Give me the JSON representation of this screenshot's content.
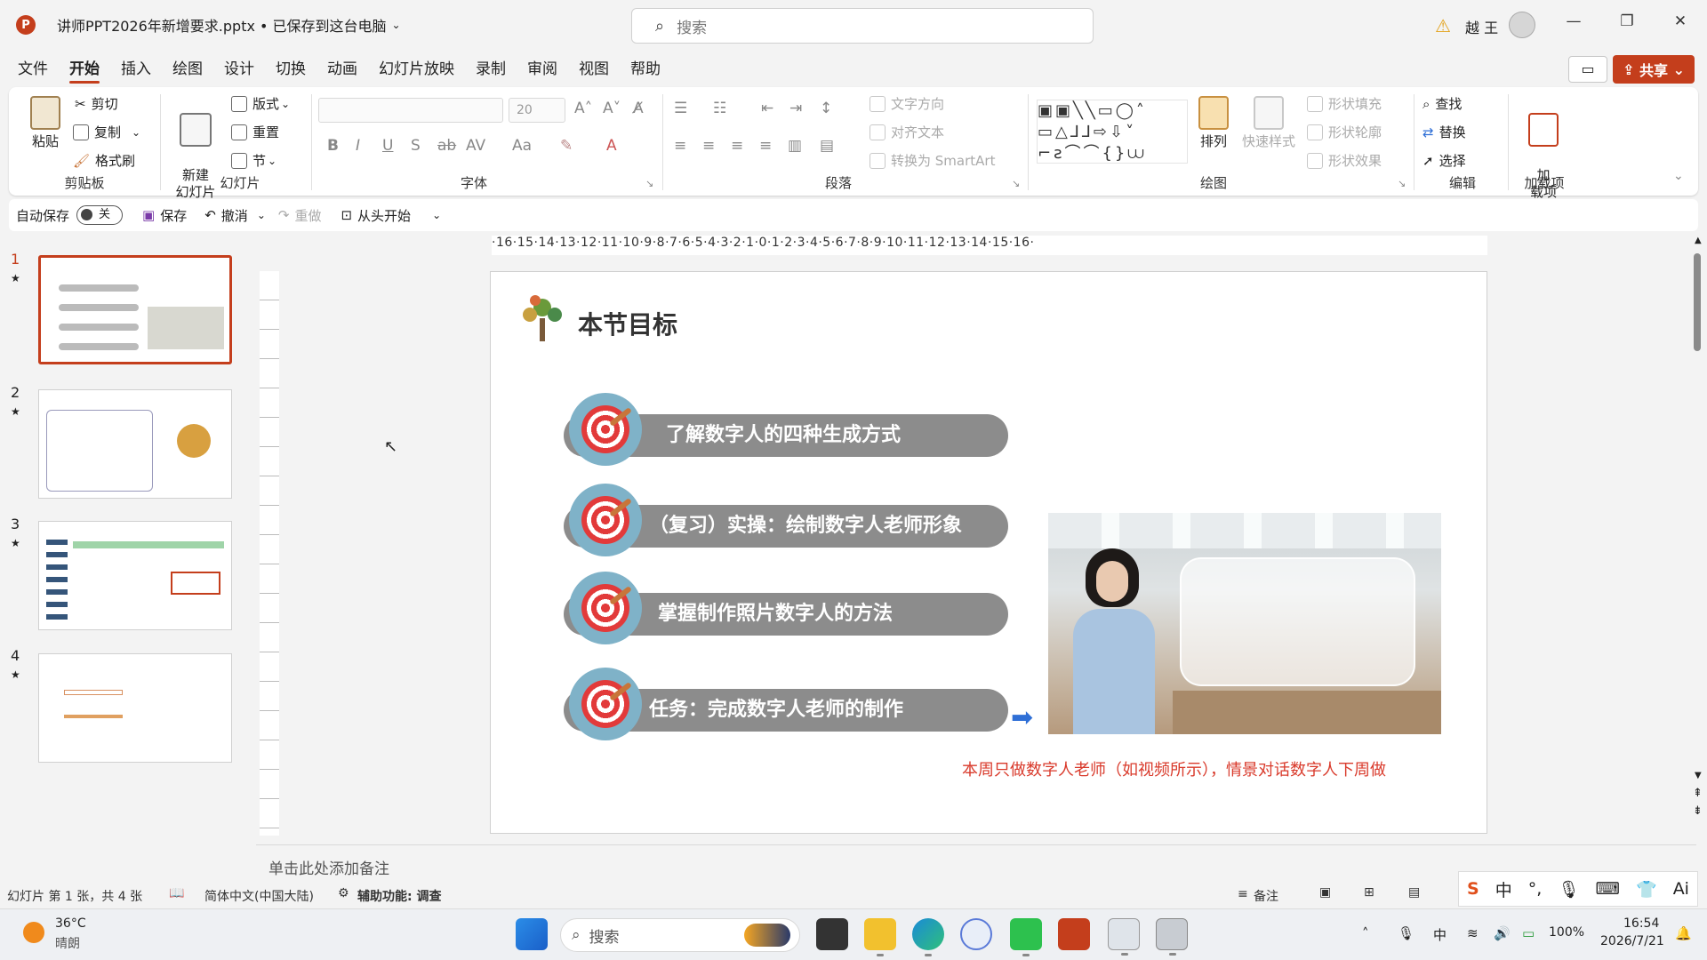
{
  "titlebar": {
    "app_icon_letter": "P",
    "doc_title": "讲师PPT2026年新增要求.pptx • 已保存到这台电脑",
    "search_placeholder": "搜索",
    "user_name": "越 王",
    "minimize": "—",
    "restore": "❐",
    "close": "✕"
  },
  "menu": {
    "tabs": [
      "文件",
      "开始",
      "插入",
      "绘图",
      "设计",
      "切换",
      "动画",
      "幻灯片放映",
      "录制",
      "审阅",
      "视图",
      "帮助"
    ],
    "active": "开始",
    "share_label": "共享"
  },
  "ribbon": {
    "clipboard": {
      "paste": "粘贴",
      "cut": "剪切",
      "copy": "复制",
      "format_painter": "格式刷",
      "label": "剪贴板"
    },
    "slides": {
      "new_slide": "新建\n幻灯片",
      "layout": "版式",
      "reset": "重置",
      "section": "节",
      "label": "幻灯片"
    },
    "font": {
      "font_name": "",
      "font_size": "20",
      "label": "字体"
    },
    "paragraph": {
      "text_direction": "文字方向",
      "align_text": "对齐文本",
      "smartart": "转换为 SmartArt",
      "label": "段落"
    },
    "drawing": {
      "arrange": "排列",
      "quick_styles": "快速样式",
      "shape_fill": "形状填充",
      "shape_outline": "形状轮廓",
      "shape_effects": "形状效果",
      "label": "绘图"
    },
    "editing": {
      "find": "查找",
      "replace": "替换",
      "select": "选择",
      "label": "编辑"
    },
    "addins": {
      "addins": "加\n载项",
      "label": "加载项"
    }
  },
  "qat": {
    "autosave": "自动保存",
    "autosave_state": "关",
    "save": "保存",
    "undo": "撤消",
    "redo": "重做",
    "from_start": "从头开始"
  },
  "thumbnails": [
    {
      "num": "1",
      "selected": true
    },
    {
      "num": "2",
      "selected": false
    },
    {
      "num": "3",
      "selected": false
    },
    {
      "num": "4",
      "selected": false
    }
  ],
  "ruler": {
    "horizontal": "·16·15·14·13·12·11·10·9·8·7·6·5·4·3·2·1·0·1·2·3·4·5·6·7·8·9·10·11·12·13·14·15·16·"
  },
  "slide": {
    "title": "本节目标",
    "goals": [
      "了解数字人的四种生成方式",
      "（复习）实操：绘制数字人老师形象",
      "掌握制作照片数字人的方法",
      "任务：完成数字人老师的制作"
    ],
    "note": "本周只做数字人老师（如视频所示），情景对话数字人下周做"
  },
  "notes_placeholder": "单击此处添加备注",
  "statusbar": {
    "slide_info": "幻灯片 第 1 张，共 4 张",
    "language": "简体中文(中国大陆)",
    "accessibility": "辅助功能: 调查",
    "notes": "备注"
  },
  "ime": {
    "logo": "S",
    "mode": "中"
  },
  "taskbar": {
    "weather_temp": "36°C",
    "weather_desc": "晴朗",
    "search": "搜索",
    "battery": "100%",
    "time": "16:54",
    "date": "2026/7/21"
  },
  "colors": {
    "accent": "#c43e1c",
    "pill": "#8c8c8c",
    "note_red": "#d93a2b",
    "arrow_blue": "#2f6fd6"
  }
}
